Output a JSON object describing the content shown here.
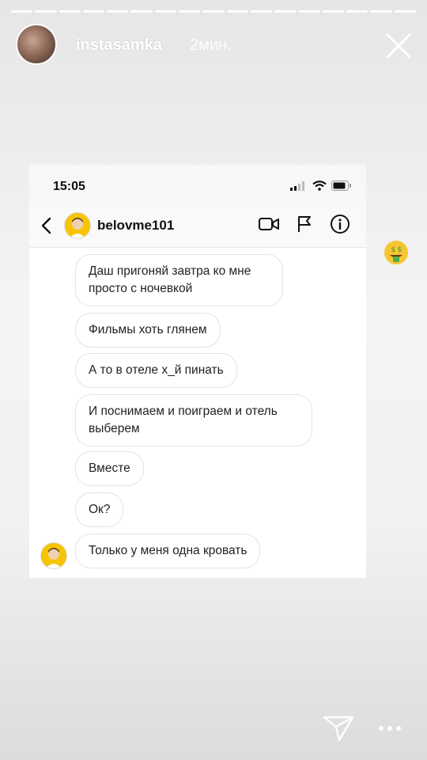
{
  "story": {
    "segments": 17,
    "username": "instasamka",
    "time_ago": "2мин."
  },
  "screenshot": {
    "status_time": "15:05",
    "chat": {
      "username": "belovme101",
      "messages": [
        {
          "text": "Даш пригоняй завтра ко мне просто с ночевкой"
        },
        {
          "text": "Фильмы хоть глянем"
        },
        {
          "text": "А то в отеле х_й пинать"
        },
        {
          "text": "И поснимаем и поиграем и отель выберем"
        },
        {
          "text": "Вместе"
        },
        {
          "text": "Ок?"
        },
        {
          "text": "Только у меня одна кровать"
        }
      ]
    }
  },
  "icons": {
    "close": "close-icon",
    "video": "video-call-icon",
    "flag": "flag-icon",
    "info": "info-icon",
    "back": "chevron-left-icon",
    "send": "send-icon",
    "more": "more-icon",
    "emoji": "money-mouth-emoji"
  },
  "colors": {
    "avatar_bg": "#f6c400",
    "bubble_border": "#e3e3e3",
    "emoji": "#f7c531"
  }
}
